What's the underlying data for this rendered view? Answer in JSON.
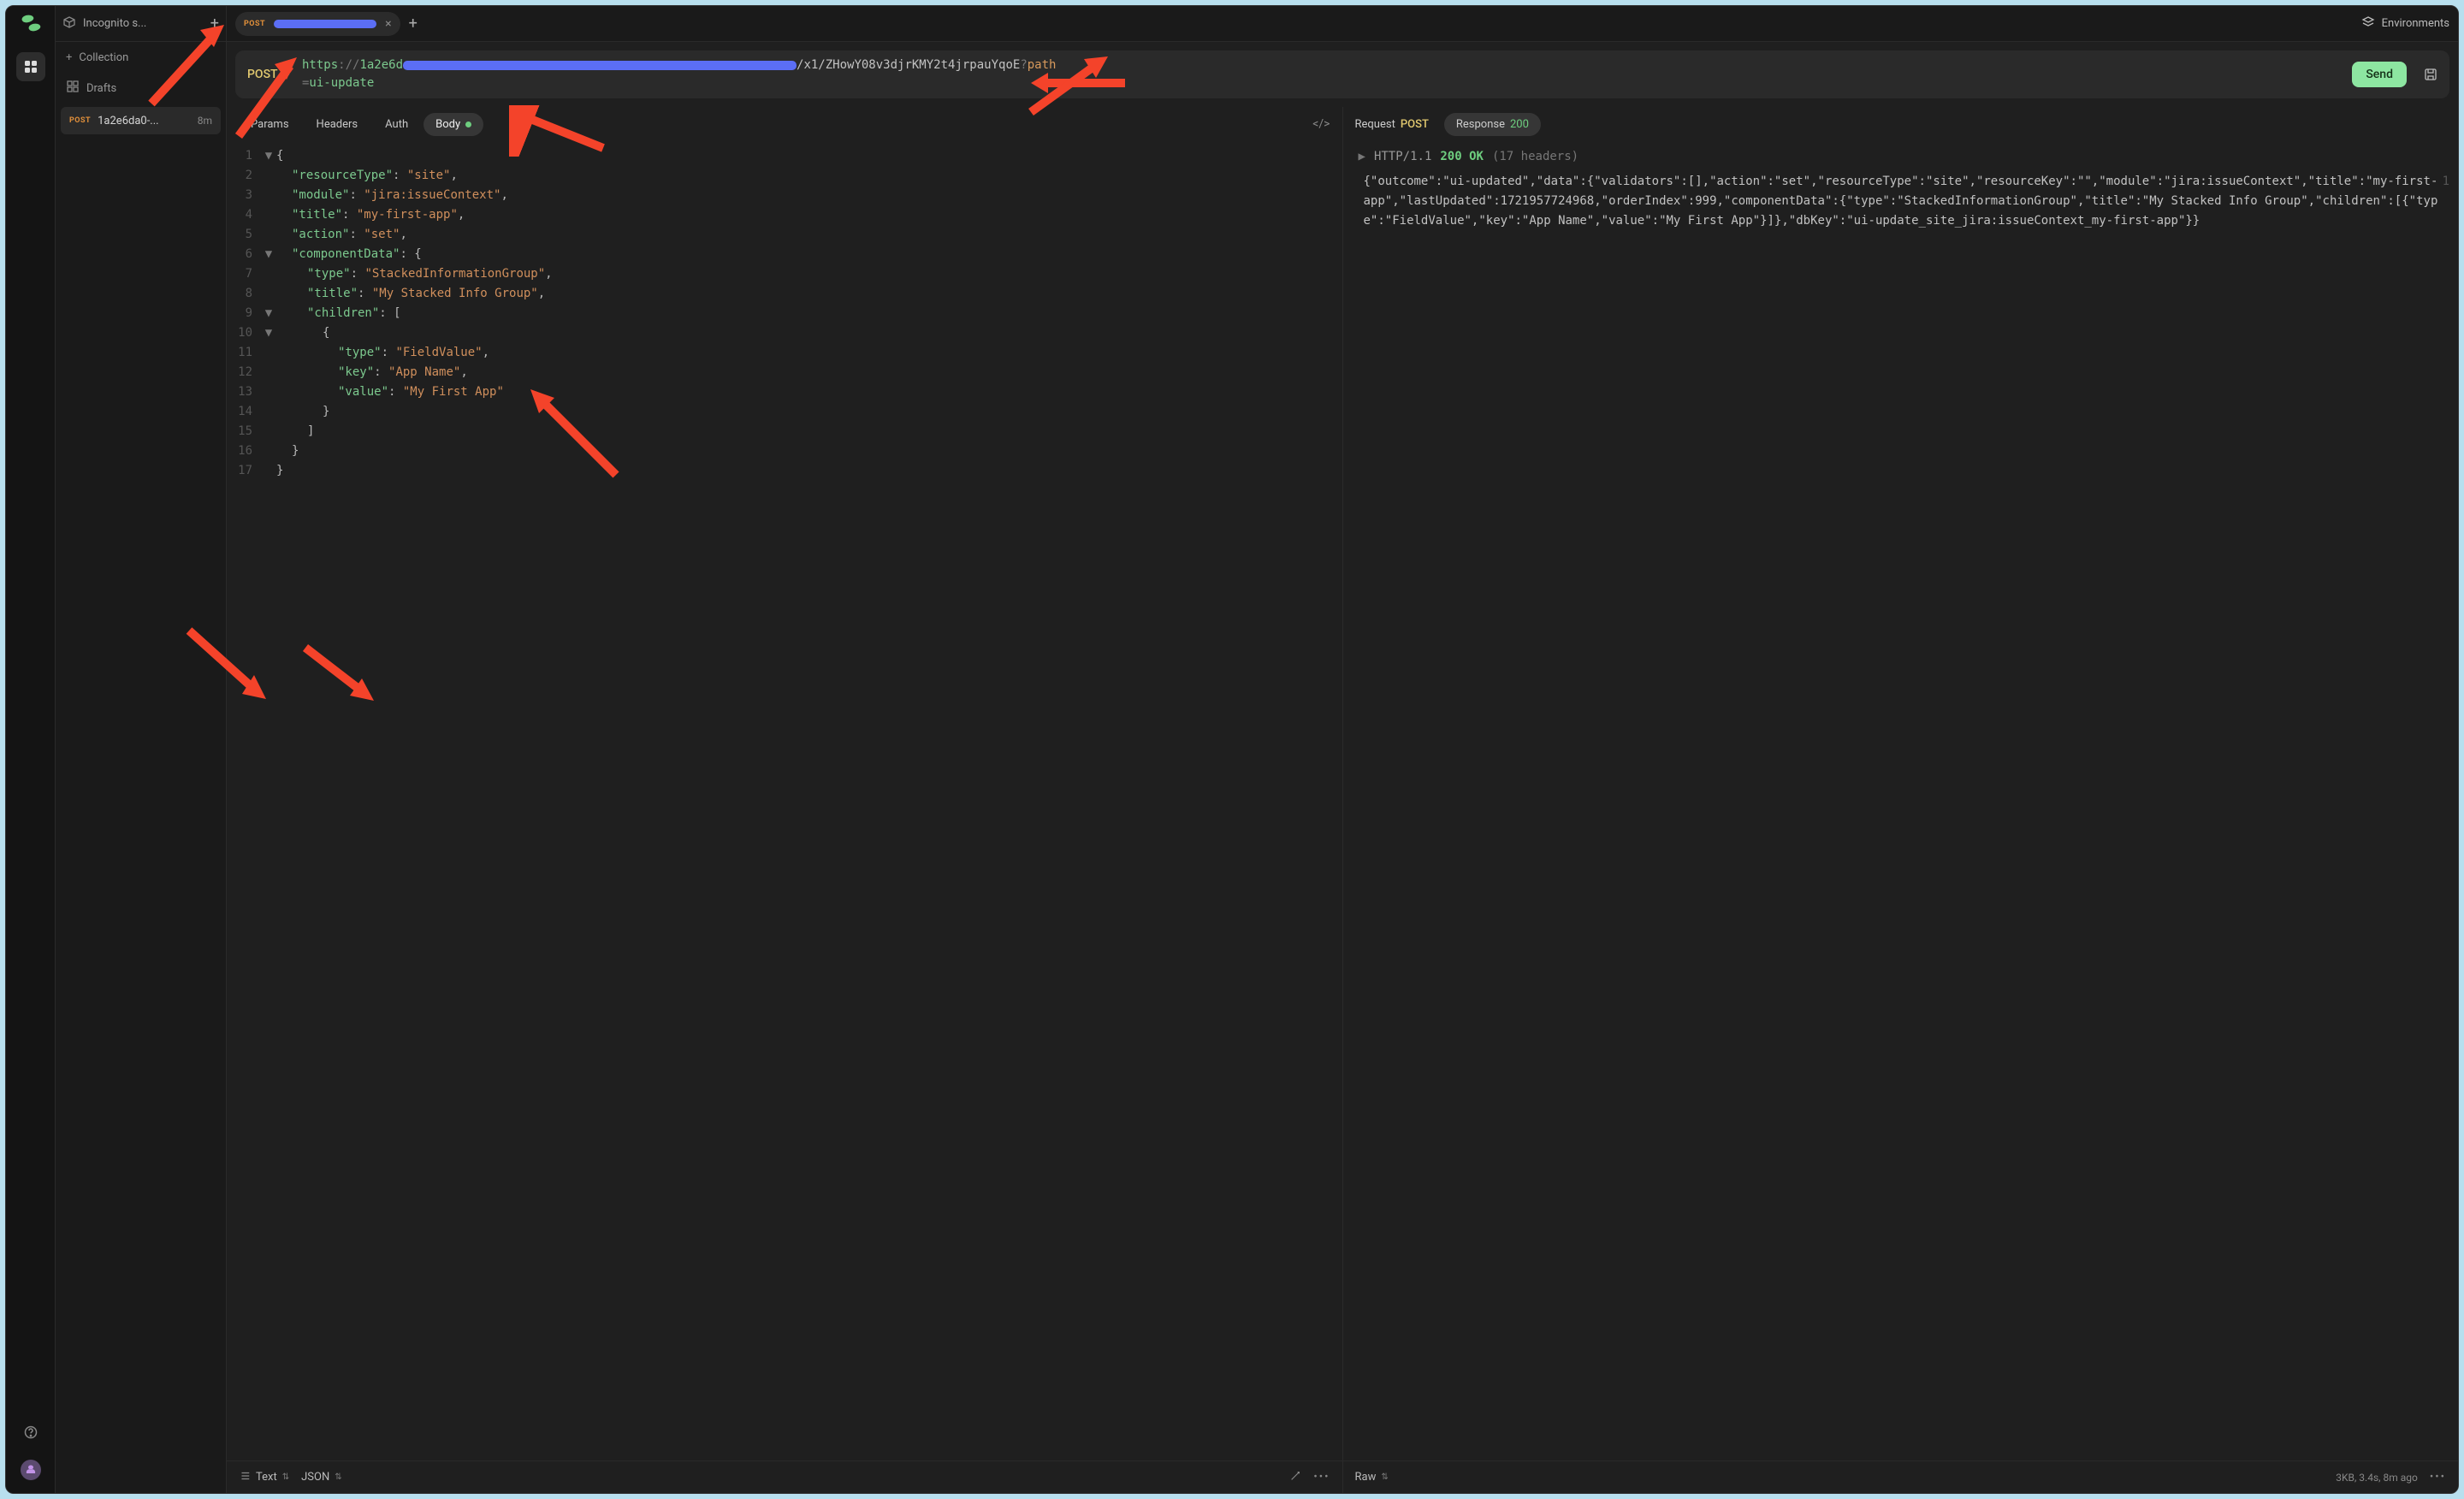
{
  "sidebar": {
    "workspace_name": "Incognito s...",
    "collection_label": "Collection",
    "drafts_label": "Drafts",
    "draft": {
      "method": "POST",
      "name": "1a2e6da0-...",
      "time": "8m"
    }
  },
  "topbar": {
    "tab_method": "POST",
    "env_label": "Environments"
  },
  "request": {
    "method": "POST",
    "url_scheme": "https",
    "url_sep": "://",
    "url_host": "1a2e6d",
    "url_path": "/x1/ZHowY08v3djrKMY2t4jrpauYqoE",
    "url_qmark": "?",
    "url_qkey": "path",
    "url_eq": "=",
    "url_qval": "ui-update",
    "send_label": "Send"
  },
  "req_tabs": {
    "params": "Params",
    "headers": "Headers",
    "auth": "Auth",
    "body": "Body"
  },
  "resp_tabs": {
    "request_label": "Request",
    "request_method": "POST",
    "response_label": "Response",
    "response_code": "200"
  },
  "editor_lines": [
    {
      "n": 1,
      "fold": "▼",
      "indent": 0,
      "tokens": [
        [
          "p",
          "{"
        ]
      ]
    },
    {
      "n": 2,
      "fold": "",
      "indent": 1,
      "tokens": [
        [
          "k",
          "\"resourceType\""
        ],
        [
          "p",
          ": "
        ],
        [
          "s",
          "\"site\""
        ],
        [
          "p",
          ","
        ]
      ]
    },
    {
      "n": 3,
      "fold": "",
      "indent": 1,
      "tokens": [
        [
          "k",
          "\"module\""
        ],
        [
          "p",
          ": "
        ],
        [
          "s",
          "\"jira:issueContext\""
        ],
        [
          "p",
          ","
        ]
      ]
    },
    {
      "n": 4,
      "fold": "",
      "indent": 1,
      "tokens": [
        [
          "k",
          "\"title\""
        ],
        [
          "p",
          ": "
        ],
        [
          "s",
          "\"my-first-app\""
        ],
        [
          "p",
          ","
        ]
      ]
    },
    {
      "n": 5,
      "fold": "",
      "indent": 1,
      "tokens": [
        [
          "k",
          "\"action\""
        ],
        [
          "p",
          ": "
        ],
        [
          "s",
          "\"set\""
        ],
        [
          "p",
          ","
        ]
      ]
    },
    {
      "n": 6,
      "fold": "▼",
      "indent": 1,
      "tokens": [
        [
          "k",
          "\"componentData\""
        ],
        [
          "p",
          ": {"
        ]
      ]
    },
    {
      "n": 7,
      "fold": "",
      "indent": 2,
      "tokens": [
        [
          "k",
          "\"type\""
        ],
        [
          "p",
          ": "
        ],
        [
          "s",
          "\"StackedInformationGroup\""
        ],
        [
          "p",
          ","
        ]
      ]
    },
    {
      "n": 8,
      "fold": "",
      "indent": 2,
      "tokens": [
        [
          "k",
          "\"title\""
        ],
        [
          "p",
          ": "
        ],
        [
          "s",
          "\"My Stacked Info Group\""
        ],
        [
          "p",
          ","
        ]
      ]
    },
    {
      "n": 9,
      "fold": "▼",
      "indent": 2,
      "tokens": [
        [
          "k",
          "\"children\""
        ],
        [
          "p",
          ": ["
        ]
      ]
    },
    {
      "n": 10,
      "fold": "▼",
      "indent": 3,
      "tokens": [
        [
          "p",
          "{"
        ]
      ]
    },
    {
      "n": 11,
      "fold": "",
      "indent": 4,
      "tokens": [
        [
          "k",
          "\"type\""
        ],
        [
          "p",
          ": "
        ],
        [
          "s",
          "\"FieldValue\""
        ],
        [
          "p",
          ","
        ]
      ]
    },
    {
      "n": 12,
      "fold": "",
      "indent": 4,
      "tokens": [
        [
          "k",
          "\"key\""
        ],
        [
          "p",
          ": "
        ],
        [
          "s",
          "\"App Name\""
        ],
        [
          "p",
          ","
        ]
      ]
    },
    {
      "n": 13,
      "fold": "",
      "indent": 4,
      "tokens": [
        [
          "k",
          "\"value\""
        ],
        [
          "p",
          ": "
        ],
        [
          "s",
          "\"My First App\""
        ]
      ]
    },
    {
      "n": 14,
      "fold": "",
      "indent": 3,
      "tokens": [
        [
          "p",
          "}"
        ]
      ]
    },
    {
      "n": 15,
      "fold": "",
      "indent": 2,
      "tokens": [
        [
          "p",
          "]"
        ]
      ]
    },
    {
      "n": 16,
      "fold": "",
      "indent": 1,
      "tokens": [
        [
          "p",
          "}"
        ]
      ]
    },
    {
      "n": 17,
      "fold": "",
      "indent": 0,
      "tokens": [
        [
          "p",
          "}"
        ]
      ]
    }
  ],
  "response": {
    "status_line_proto": "HTTP/1.1",
    "status_line_code": "200 OK",
    "headers_count": "(17 headers)",
    "body": "{\"outcome\":\"ui-updated\",\"data\":{\"validators\":[],\"action\":\"set\",\"resourceType\":\"site\",\"resourceKey\":\"\",\"module\":\"jira:issueContext\",\"title\":\"my-first-app\",\"lastUpdated\":1721957724968,\"orderIndex\":999,\"componentData\":{\"type\":\"StackedInformationGroup\",\"title\":\"My Stacked Info Group\",\"children\":[{\"type\":\"FieldValue\",\"key\":\"App Name\",\"value\":\"My First App\"}]},\"dbKey\":\"ui-update_site_jira:issueContext_my-first-app\"}}",
    "line_num": "1"
  },
  "footer": {
    "text_label": "Text",
    "format_label": "JSON",
    "raw_label": "Raw",
    "stats": "3KB, 3.4s, 8m ago"
  },
  "colors": {
    "accent_green": "#8de6a1",
    "accent_orange": "#e08f3a",
    "accent_blue": "#5b6ef5"
  }
}
